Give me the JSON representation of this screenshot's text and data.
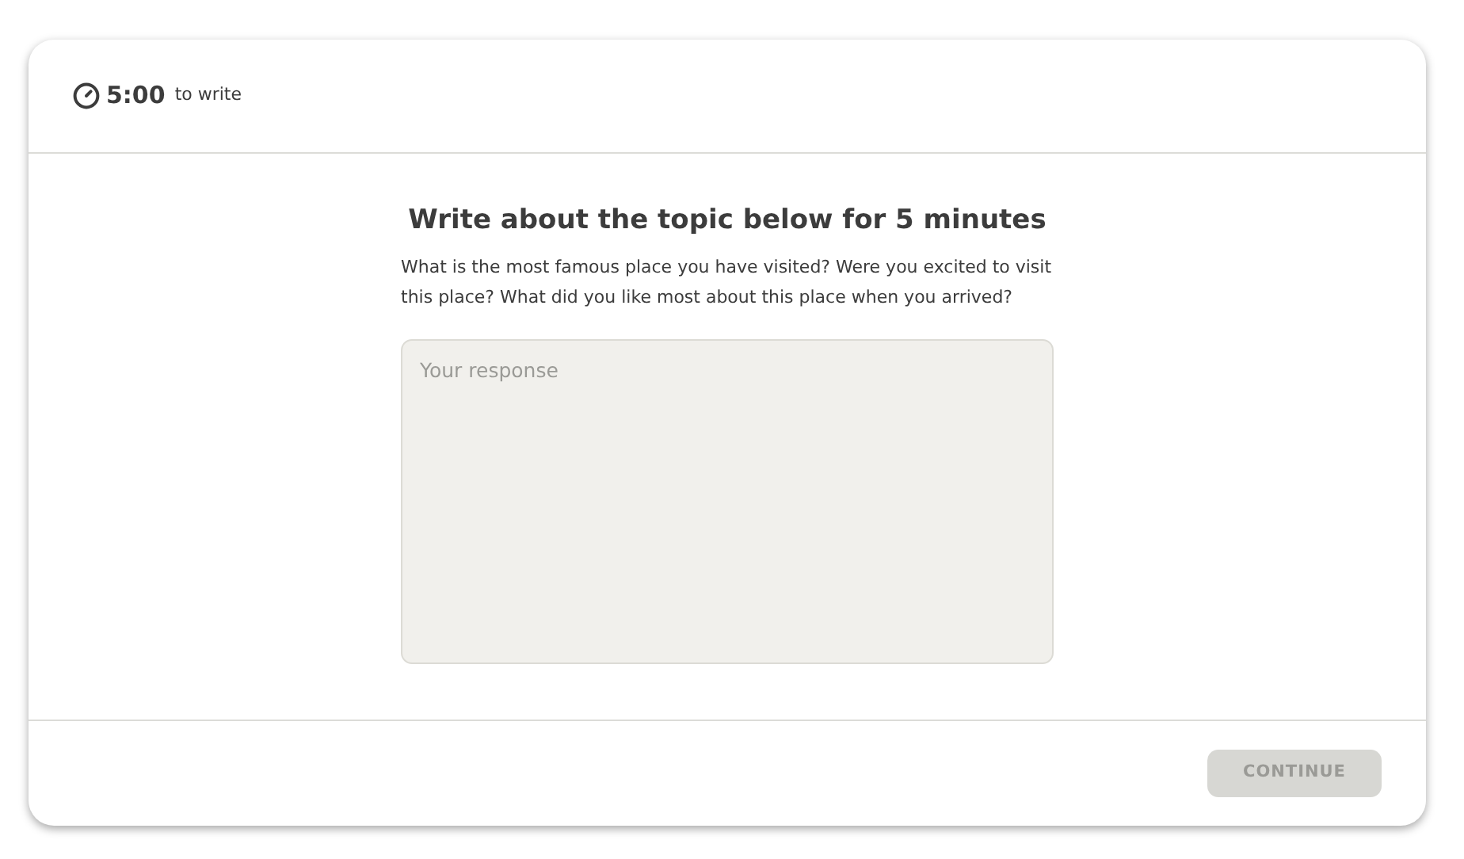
{
  "timer": {
    "time": "5:00",
    "suffix": "to write"
  },
  "heading": "Write about the topic below for 5 minutes",
  "prompt": "What is the most famous place you have visited? Were you excited to visit this place? What did you like most about this place when you arrived?",
  "response": {
    "placeholder": "Your response"
  },
  "continue_button": {
    "label": "CONTINUE",
    "disabled": true
  }
}
